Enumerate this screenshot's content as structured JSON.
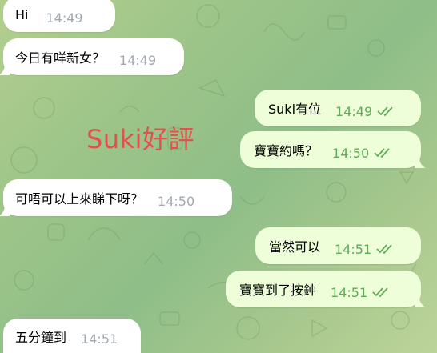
{
  "overlay": {
    "watermark": "Suki好評"
  },
  "messages": [
    {
      "id": "m1",
      "direction": "in",
      "text": "Hi",
      "time": "14:49"
    },
    {
      "id": "m2",
      "direction": "in",
      "text": "今日有咩新女？",
      "time": "14:49"
    },
    {
      "id": "m3",
      "direction": "out",
      "text": "Suki有位",
      "time": "14:49",
      "read": true
    },
    {
      "id": "m4",
      "direction": "out",
      "text": "寶寶約嗎？",
      "time": "14:50",
      "read": true
    },
    {
      "id": "m5",
      "direction": "in",
      "text": "可唔可以上來睇下呀？",
      "time": "14:50"
    },
    {
      "id": "m6",
      "direction": "out",
      "text": "當然可以",
      "time": "14:51",
      "read": true
    },
    {
      "id": "m7",
      "direction": "out",
      "text": "寶寶到了按鈡",
      "time": "14:51",
      "read": true
    },
    {
      "id": "m8",
      "direction": "in",
      "text": "五分鐘到",
      "time": "14:51"
    }
  ],
  "icons": {
    "read_receipt": "double-check-icon"
  },
  "colors": {
    "incoming_bubble": "#ffffff",
    "outgoing_bubble": "#eefed9",
    "outgoing_time": "#5dac56",
    "incoming_time": "#a0a8b0",
    "watermark": "#e2514e"
  }
}
